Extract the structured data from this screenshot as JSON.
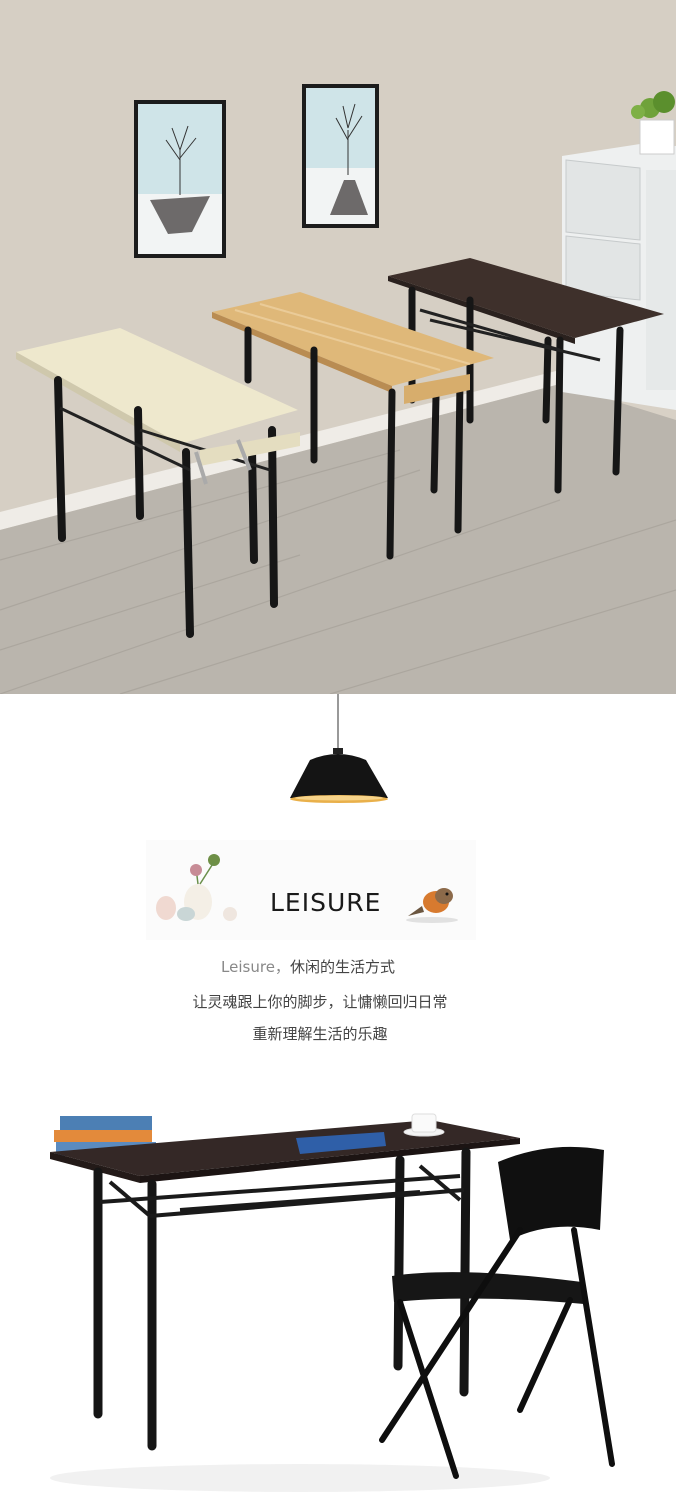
{
  "hero": {
    "description_icon": "folding-tables-room-photo"
  },
  "lamp": {
    "icon": "pendant-lamp-icon"
  },
  "leisure": {
    "title": "LEISURE",
    "decor_left_icon": "vases-icon",
    "decor_right_icon": "bird-icon"
  },
  "tagline": {
    "line1_latin": "Leisure，",
    "line1_cn": "休闲的生活方式",
    "line2": "让灵魂跟上你的脚步，让慵懒回归日常",
    "line3": "重新理解生活的乐趣"
  },
  "bottom": {
    "icon": "desk-and-folding-chair-photo"
  },
  "colors": {
    "wall": "#d9d2c7",
    "floor": "#b9b4ac",
    "frame": "#1a1a1a",
    "table_light": "#efe9cf",
    "table_oak": "#dfb77a",
    "table_dark": "#3d302b"
  }
}
